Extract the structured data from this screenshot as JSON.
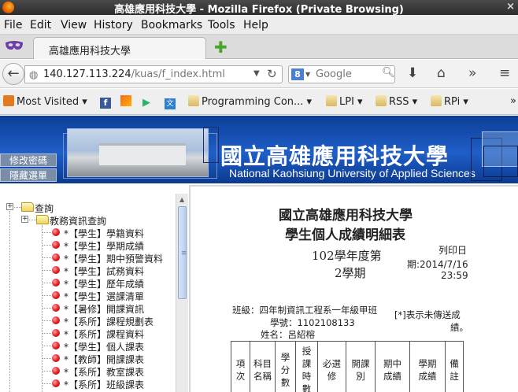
{
  "window": {
    "title": "高雄應用科技大學 - Mozilla Firefox (Private Browsing)",
    "close_glyph": "×"
  },
  "menu": [
    "File",
    "Edit",
    "View",
    "History",
    "Bookmarks",
    "Tools",
    "Help"
  ],
  "tab": {
    "label": "高雄應用科技大學",
    "new_tab_glyph": "✚"
  },
  "nav": {
    "url_host": "140.127.113.224",
    "url_path": "/kuas/f_index.html",
    "search_placeholder": "Google",
    "search_engine_letter": "8"
  },
  "bookmarks": [
    "Most Visited",
    "Programming Con...",
    "LPI",
    "RSS",
    "RPi"
  ],
  "banner": {
    "name_zh": "國立高雄應用科技大學",
    "name_en": "National Kaohsiung University of Applied Sciences",
    "buttons": [
      "修改密碼",
      "隱藏選單"
    ]
  },
  "tree": {
    "root": "查詢",
    "folder": "教務資訊查詢",
    "items": [
      "*【學生】學籍資料",
      "*【學生】學期成績",
      "*【學生】期中預警資料",
      "*【學生】試務資料",
      "*【學生】歷年成績",
      "*【學生】選課清單",
      "*【暑修】開課資訊",
      "*【系所】課程規劃表",
      "*【系所】課程資料",
      "*【學生】個人課表",
      "*【教師】開課課表",
      "*【系所】教室課表",
      "*【系所】班級課表"
    ]
  },
  "report": {
    "title": "國立高雄應用科技大學",
    "subtitle": "學生個人成績明細表",
    "year_line1": "102學年度第",
    "year_line2": "2學期",
    "print_line1": "列印日",
    "print_line2": "期:2014/7/16",
    "print_line3": "23:59",
    "class_label": "班級：四年制資訊工程系一年級甲班",
    "id_label": "學號：1102108133",
    "name_label": "姓名：呂紹榕",
    "note_line1": "[*]表示未傳送成",
    "note_line2": "績。",
    "table_headers": [
      "項次",
      "科目名稱",
      "學分數",
      "授課時數",
      "必選修",
      "開課別",
      "期中成績",
      "學期成績",
      "備註"
    ]
  },
  "colors": {
    "banner_blue": "#1f5fc8",
    "tree_dot_red": "#d8141f",
    "firefox_orange": "#e66000"
  }
}
